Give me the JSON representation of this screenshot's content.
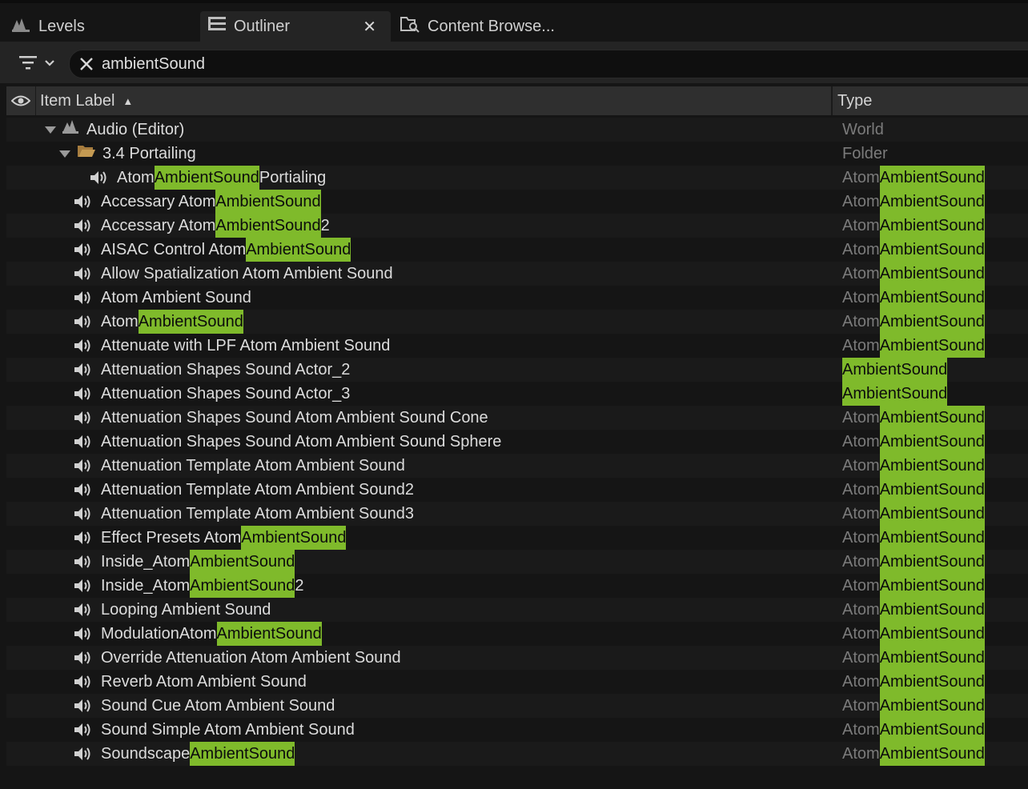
{
  "tabs": [
    {
      "label": "Levels",
      "icon": "levels-icon",
      "active": false
    },
    {
      "label": "Outliner",
      "icon": "outliner-icon",
      "active": true
    },
    {
      "label": "Content Browse...",
      "icon": "content-browser-icon",
      "active": false
    }
  ],
  "search": {
    "value": "ambientSound"
  },
  "columns": {
    "label": "Item Label",
    "type": "Type"
  },
  "tree": {
    "world": {
      "label": "Audio (Editor)",
      "type": "World"
    },
    "folder": {
      "label": "3.4 Portailing",
      "type": "Folder"
    }
  },
  "highlight_color": "#7fba2b",
  "items": [
    {
      "pre": "Atom",
      "hl": "AmbientSound",
      "post": " Portialing",
      "tpre": "Atom",
      "thl": "AmbientSound",
      "nested": true
    },
    {
      "pre": "Accessary Atom",
      "hl": "AmbientSound",
      "post": "",
      "tpre": "Atom",
      "thl": "AmbientSound"
    },
    {
      "pre": "Accessary Atom",
      "hl": "AmbientSound",
      "post": "2",
      "tpre": "Atom",
      "thl": "AmbientSound"
    },
    {
      "pre": "AISAC Control Atom",
      "hl": "AmbientSound",
      "post": "",
      "tpre": "Atom",
      "thl": "AmbientSound"
    },
    {
      "pre": "Allow Spatialization Atom Ambient Sound",
      "hl": "",
      "post": "",
      "tpre": "Atom",
      "thl": "AmbientSound"
    },
    {
      "pre": "Atom Ambient Sound",
      "hl": "",
      "post": "",
      "tpre": "Atom",
      "thl": "AmbientSound"
    },
    {
      "pre": "Atom",
      "hl": "AmbientSound",
      "post": "",
      "tpre": "Atom",
      "thl": "AmbientSound"
    },
    {
      "pre": "Attenuate with LPF Atom Ambient Sound",
      "hl": "",
      "post": "",
      "tpre": "Atom",
      "thl": "AmbientSound"
    },
    {
      "pre": "Attenuation Shapes Sound Actor_2",
      "hl": "",
      "post": "",
      "tpre": "",
      "thl": "AmbientSound"
    },
    {
      "pre": "Attenuation Shapes Sound Actor_3",
      "hl": "",
      "post": "",
      "tpre": "",
      "thl": "AmbientSound"
    },
    {
      "pre": "Attenuation Shapes Sound Atom Ambient Sound Cone",
      "hl": "",
      "post": "",
      "tpre": "Atom",
      "thl": "AmbientSound"
    },
    {
      "pre": "Attenuation Shapes Sound Atom Ambient Sound Sphere",
      "hl": "",
      "post": "",
      "tpre": "Atom",
      "thl": "AmbientSound"
    },
    {
      "pre": "Attenuation Template Atom Ambient Sound",
      "hl": "",
      "post": "",
      "tpre": "Atom",
      "thl": "AmbientSound"
    },
    {
      "pre": "Attenuation Template Atom Ambient Sound2",
      "hl": "",
      "post": "",
      "tpre": "Atom",
      "thl": "AmbientSound"
    },
    {
      "pre": "Attenuation Template Atom Ambient Sound3",
      "hl": "",
      "post": "",
      "tpre": "Atom",
      "thl": "AmbientSound"
    },
    {
      "pre": "Effect Presets Atom",
      "hl": "AmbientSound",
      "post": "",
      "tpre": "Atom",
      "thl": "AmbientSound"
    },
    {
      "pre": "Inside_Atom",
      "hl": "AmbientSound",
      "post": "",
      "tpre": "Atom",
      "thl": "AmbientSound"
    },
    {
      "pre": "Inside_Atom",
      "hl": "AmbientSound",
      "post": "2",
      "tpre": "Atom",
      "thl": "AmbientSound"
    },
    {
      "pre": "Looping Ambient Sound",
      "hl": "",
      "post": "",
      "tpre": "Atom",
      "thl": "AmbientSound"
    },
    {
      "pre": "ModulationAtom",
      "hl": "AmbientSound",
      "post": "",
      "tpre": "Atom",
      "thl": "AmbientSound"
    },
    {
      "pre": "Override Attenuation Atom Ambient Sound",
      "hl": "",
      "post": "",
      "tpre": "Atom",
      "thl": "AmbientSound"
    },
    {
      "pre": "Reverb Atom Ambient Sound",
      "hl": "",
      "post": "",
      "tpre": "Atom",
      "thl": "AmbientSound"
    },
    {
      "pre": "Sound Cue Atom Ambient Sound",
      "hl": "",
      "post": "",
      "tpre": "Atom",
      "thl": "AmbientSound"
    },
    {
      "pre": "Sound Simple Atom Ambient Sound",
      "hl": "",
      "post": "",
      "tpre": "Atom",
      "thl": "AmbientSound"
    },
    {
      "pre": "Soundscape",
      "hl": "AmbientSound",
      "post": "",
      "tpre": "Atom",
      "thl": "AmbientSound"
    }
  ]
}
